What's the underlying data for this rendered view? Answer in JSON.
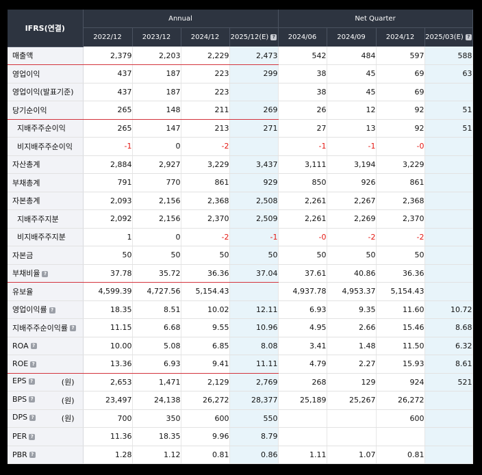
{
  "header": {
    "corner": "IFRS(연결)",
    "annual_label": "Annual",
    "quarter_label": "Net Quarter",
    "periods": [
      "2022/12",
      "2023/12",
      "2024/12",
      "2025/12(E)",
      "2024/06",
      "2024/09",
      "2024/12",
      "2025/03(E)"
    ]
  },
  "rows": [
    {
      "label": "매출액",
      "values": [
        "2,379",
        "2,203",
        "2,229",
        "2,473",
        "542",
        "484",
        "597",
        "588"
      ]
    },
    {
      "label": "영업이익",
      "values": [
        "437",
        "187",
        "223",
        "299",
        "38",
        "45",
        "69",
        "63"
      ]
    },
    {
      "label": "영업이익(발표기준)",
      "values": [
        "437",
        "187",
        "223",
        "",
        "38",
        "45",
        "69",
        ""
      ]
    },
    {
      "label": "당기순이익",
      "values": [
        "265",
        "148",
        "211",
        "269",
        "26",
        "12",
        "92",
        "51"
      ]
    },
    {
      "label": "지배주주순이익",
      "values": [
        "265",
        "147",
        "213",
        "271",
        "27",
        "13",
        "92",
        "51"
      ]
    },
    {
      "label": "비지배주주순이익",
      "values": [
        "-1",
        "0",
        "-2",
        "",
        "-1",
        "-1",
        "-0",
        ""
      ]
    },
    {
      "label": "자산총계",
      "values": [
        "2,884",
        "2,927",
        "3,229",
        "3,437",
        "3,111",
        "3,194",
        "3,229",
        ""
      ]
    },
    {
      "label": "부채총계",
      "values": [
        "791",
        "770",
        "861",
        "929",
        "850",
        "926",
        "861",
        ""
      ]
    },
    {
      "label": "자본총계",
      "values": [
        "2,093",
        "2,156",
        "2,368",
        "2,508",
        "2,261",
        "2,267",
        "2,368",
        ""
      ]
    },
    {
      "label": "지배주주지분",
      "values": [
        "2,092",
        "2,156",
        "2,370",
        "2,509",
        "2,261",
        "2,269",
        "2,370",
        ""
      ]
    },
    {
      "label": "비지배주주지분",
      "values": [
        "1",
        "0",
        "-2",
        "-1",
        "-0",
        "-2",
        "-2",
        ""
      ]
    },
    {
      "label": "자본금",
      "values": [
        "50",
        "50",
        "50",
        "50",
        "50",
        "50",
        "50",
        ""
      ]
    },
    {
      "label": "부채비율",
      "values": [
        "37.78",
        "35.72",
        "36.36",
        "37.04",
        "37.61",
        "40.86",
        "36.36",
        ""
      ]
    },
    {
      "label": "유보율",
      "values": [
        "4,599.39",
        "4,727.56",
        "5,154.43",
        "",
        "4,937.78",
        "4,953.37",
        "5,154.43",
        ""
      ]
    },
    {
      "label": "영업이익률",
      "values": [
        "18.35",
        "8.51",
        "10.02",
        "12.11",
        "6.93",
        "9.35",
        "11.60",
        "10.72"
      ]
    },
    {
      "label": "지배주주순이익률",
      "values": [
        "11.15",
        "6.68",
        "9.55",
        "10.96",
        "4.95",
        "2.66",
        "15.46",
        "8.68"
      ]
    },
    {
      "label": "ROA",
      "values": [
        "10.00",
        "5.08",
        "6.85",
        "8.08",
        "3.41",
        "1.48",
        "11.50",
        "6.32"
      ]
    },
    {
      "label": "ROE",
      "values": [
        "13.36",
        "6.93",
        "9.41",
        "11.11",
        "4.79",
        "2.27",
        "15.93",
        "8.61"
      ]
    },
    {
      "label": "EPS",
      "unit": "(원)",
      "values": [
        "2,653",
        "1,471",
        "2,129",
        "2,769",
        "268",
        "129",
        "924",
        "521"
      ]
    },
    {
      "label": "BPS",
      "unit": "(원)",
      "values": [
        "23,497",
        "24,138",
        "26,272",
        "28,377",
        "25,189",
        "25,267",
        "26,272",
        ""
      ]
    },
    {
      "label": "DPS",
      "unit": "(원)",
      "values": [
        "700",
        "350",
        "600",
        "550",
        "",
        "",
        "600",
        ""
      ]
    },
    {
      "label": "PER",
      "values": [
        "11.36",
        "18.35",
        "9.96",
        "8.79",
        "",
        "",
        "",
        ""
      ]
    },
    {
      "label": "PBR",
      "values": [
        "1.28",
        "1.12",
        "0.81",
        "0.86",
        "1.11",
        "1.07",
        "0.81",
        ""
      ]
    }
  ]
}
